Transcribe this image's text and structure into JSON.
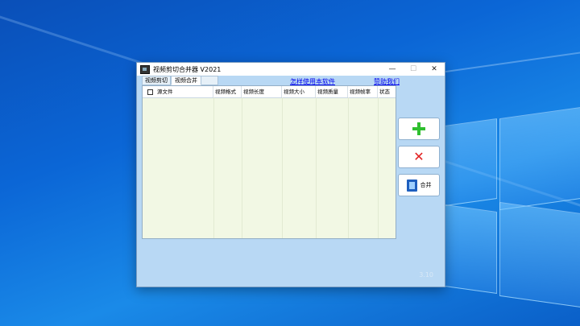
{
  "window": {
    "title": "视频剪切合并器 V2021",
    "controls": {
      "minimize": "—",
      "maximize": "☐",
      "close": "✕"
    }
  },
  "tabs": [
    {
      "label": "视频剪切",
      "active": false
    },
    {
      "label": "视频合并",
      "active": true
    }
  ],
  "links": {
    "howto": "怎样使用本软件",
    "donate": "赞助我们"
  },
  "table": {
    "columns": [
      "源文件",
      "视频格式",
      "视频长度",
      "视频大小",
      "视频质量",
      "视频帧率",
      "状态"
    ],
    "rows": []
  },
  "buttons": {
    "add_icon": "plus-icon",
    "remove_icon": "cross-icon",
    "merge_label": "合并",
    "merge_icon": "film-icon"
  },
  "footer": {
    "version": "3.10"
  },
  "colors": {
    "window_bg": "#b8d8f4",
    "table_bg": "#f2f8e4",
    "link": "#0000ee",
    "add": "#2fbf2f",
    "remove": "#e22020"
  }
}
